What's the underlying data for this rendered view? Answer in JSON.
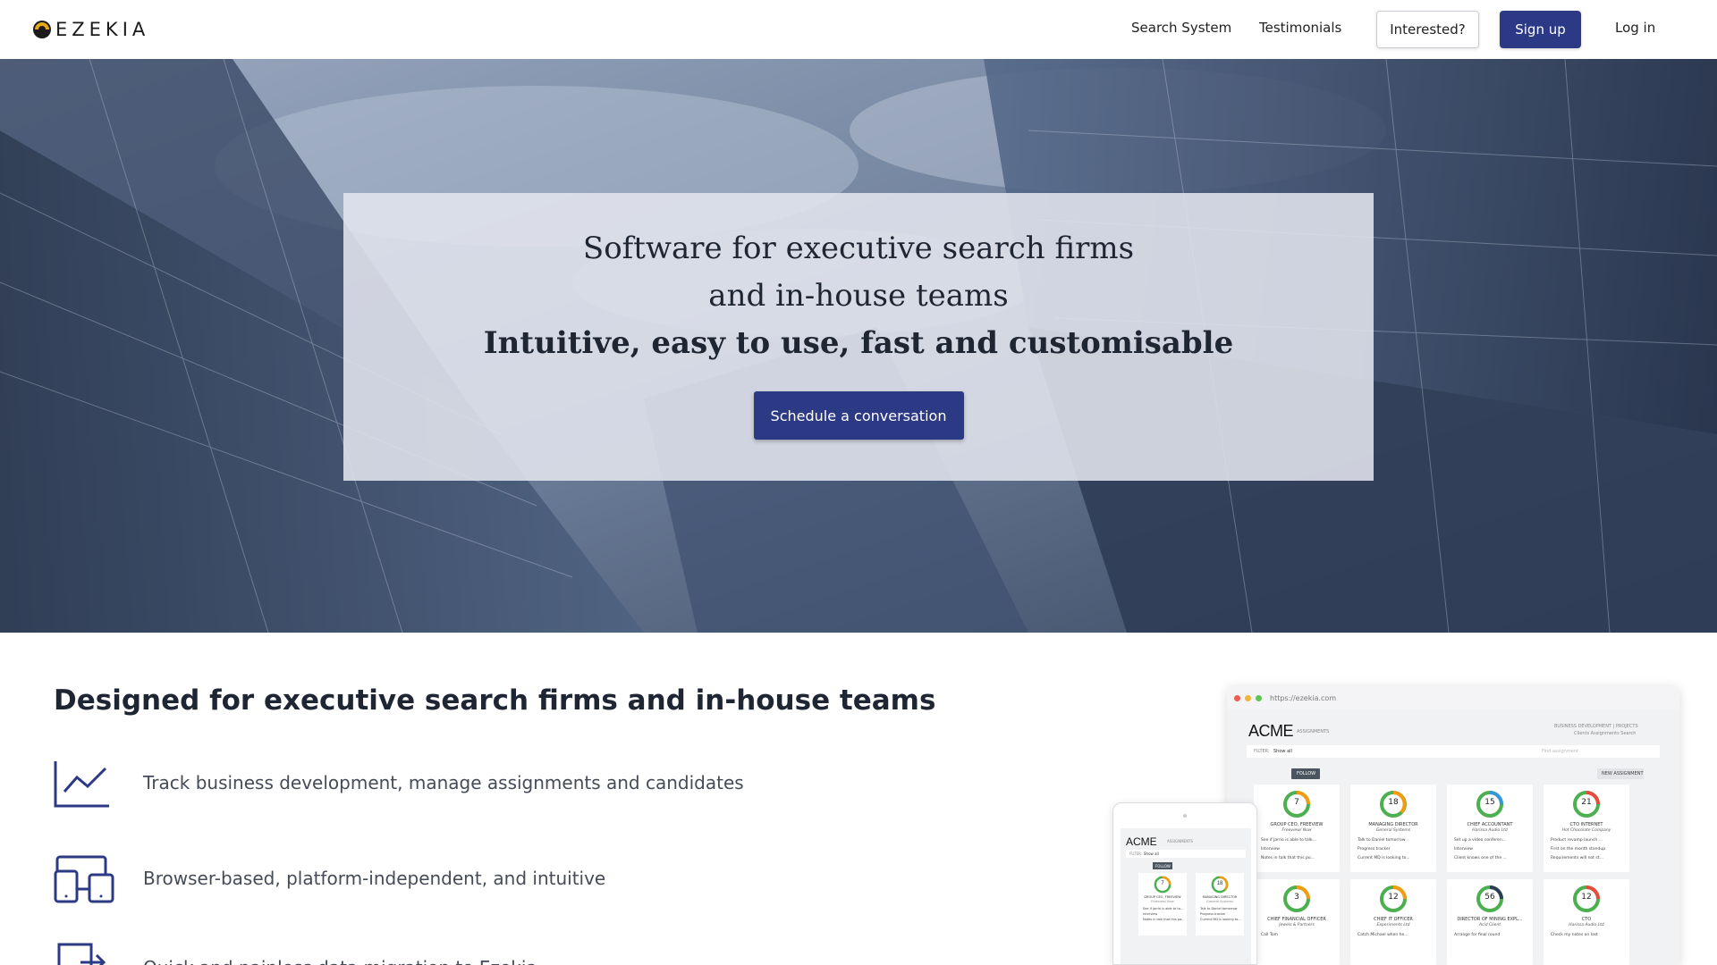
{
  "brand": {
    "name": "EZEKIA"
  },
  "nav": {
    "links": [
      "Search System",
      "Testimonials"
    ],
    "interested_label": "Interested?",
    "signup_label": "Sign up",
    "login_label": "Log in"
  },
  "hero": {
    "line1": "Software for executive search firms",
    "line2": "and in-house teams",
    "tagline": "Intuitive, easy to use, fast and customisable",
    "cta_label": "Schedule a conversation"
  },
  "features": {
    "title": "Designed for executive search firms and in-house teams",
    "items": [
      {
        "icon": "line-chart-icon",
        "text": "Track business development, manage assignments and candidates"
      },
      {
        "icon": "devices-icon",
        "text": "Browser-based, platform-independent, and intuitive"
      },
      {
        "icon": "import-icon",
        "text": "Quick and painless data migration to Ezekia"
      }
    ]
  },
  "mockup": {
    "url": "https://ezekia.com",
    "brand": "ACME",
    "section_label": "ASSIGNMENTS",
    "nav_text": "BUSINESS DEVELOPMENT | PROJECTS",
    "subnav_text": "Clients  Assignments  Search",
    "filter_label": "FILTER:",
    "filter_value": "Show all",
    "search_placeholder": "Find assignment",
    "follow_label": "FOLLOW",
    "new_label": "NEW ASSIGNMENT",
    "cards": [
      {
        "count": "7",
        "title": "GROUP CEO, FREEVIEW",
        "company": "Freeview/ Now",
        "tasks": [
          "See if Jarrio is able to talk...",
          "Interview",
          "Notes in talk that this po..."
        ]
      },
      {
        "count": "18",
        "title": "MANAGING DIRECTOR",
        "company": "General Systems",
        "tasks": [
          "Talk to Daniel tomorrow",
          "Progress tracker",
          "Current MD is looking to..."
        ]
      },
      {
        "count": "15",
        "title": "CHIEF ACCOUNTANT",
        "company": "Harissa Audio Ltd",
        "tasks": [
          "Set up a video conferen...",
          "Interview",
          "Client knows one of the ..."
        ]
      },
      {
        "count": "21",
        "title": "CTO INTERNET",
        "company": "Hot Chocolate Company",
        "tasks": [
          "Product revamp launch ...",
          "First on the month standup",
          "Requirements will not st..."
        ]
      },
      {
        "count": "3",
        "title": "CHIEF FINANCIAL OFFICER",
        "company": "Jewels & Partners",
        "tasks": [
          "Call Tom"
        ]
      },
      {
        "count": "12",
        "title": "CHIEF IT OFFICER",
        "company": "Experiments Ltd",
        "tasks": [
          "Catch Michael when he..."
        ]
      },
      {
        "count": "56",
        "title": "DIRECTOR OF MINING EXPL...",
        "company": "Acid Client",
        "tasks": [
          "Arrange for final round"
        ]
      },
      {
        "count": "12",
        "title": "CTO",
        "company": "Harissa Audio Ltd",
        "tasks": [
          "Check my notes on last"
        ]
      }
    ],
    "tablet": {
      "brand": "ACME",
      "section_label": "ASSIGNMENTS",
      "filter_label": "FILTER:",
      "filter_value": "Show all",
      "follow_label": "FOLLOW",
      "cards": [
        {
          "count": "7",
          "title": "GROUP CEO, FREEVIEW",
          "company": "Freeview/ Now",
          "tasks": [
            "See if Jarrio is able to ta...",
            "Interview",
            "Notes in talk that this po..."
          ]
        },
        {
          "count": "18",
          "title": "MANAGING DIRECTOR",
          "company": "General Systems",
          "tasks": [
            "Talk to Daniel tomorrow",
            "Progress tracker",
            "Current MD is looking to..."
          ]
        }
      ]
    }
  },
  "colors": {
    "primary": "#2c3a85",
    "hero_overlay": "#e2e5ee",
    "text_dark": "#1f2633",
    "text_muted": "#454b57"
  }
}
